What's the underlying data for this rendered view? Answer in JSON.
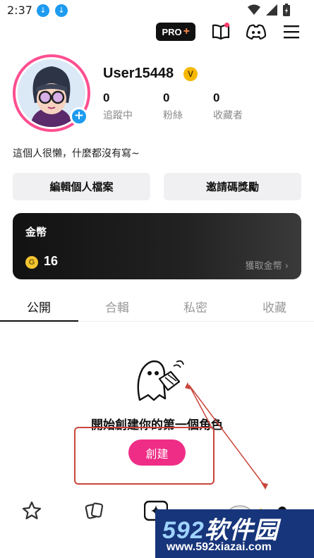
{
  "status_bar": {
    "time": "2:37"
  },
  "toolbar": {
    "pro_label": "PRO",
    "pro_plus": "+"
  },
  "profile": {
    "username": "User15448",
    "verified_badge": "V",
    "stats": [
      {
        "value": "0",
        "label": "追蹤中"
      },
      {
        "value": "0",
        "label": "粉絲"
      },
      {
        "value": "0",
        "label": "收藏者"
      }
    ],
    "bio": "這個人很懶，什麼都沒有寫~",
    "avatar_add": "+"
  },
  "actions": {
    "edit_profile": "編輯個人檔案",
    "invite_reward": "邀請碼獎勵"
  },
  "coins": {
    "title": "金幣",
    "coin_symbol": "G",
    "amount": "16",
    "get_coins": "獲取金幣 ›"
  },
  "tabs": [
    {
      "label": "公開",
      "active": true
    },
    {
      "label": "合輯",
      "active": false
    },
    {
      "label": "私密",
      "active": false
    },
    {
      "label": "收藏",
      "active": false
    }
  ],
  "empty_state": {
    "message": "開始創建你的第一個角色",
    "create_button": "創建"
  },
  "watermark": {
    "brand_num": "592",
    "brand_text": "软件园",
    "url": "www.592xiazai.com"
  },
  "colors": {
    "accent": "#ef2d86",
    "avatar_ring": "#ff4f91",
    "link_blue": "#1e9bf0",
    "annotation_red": "#c9453b"
  }
}
